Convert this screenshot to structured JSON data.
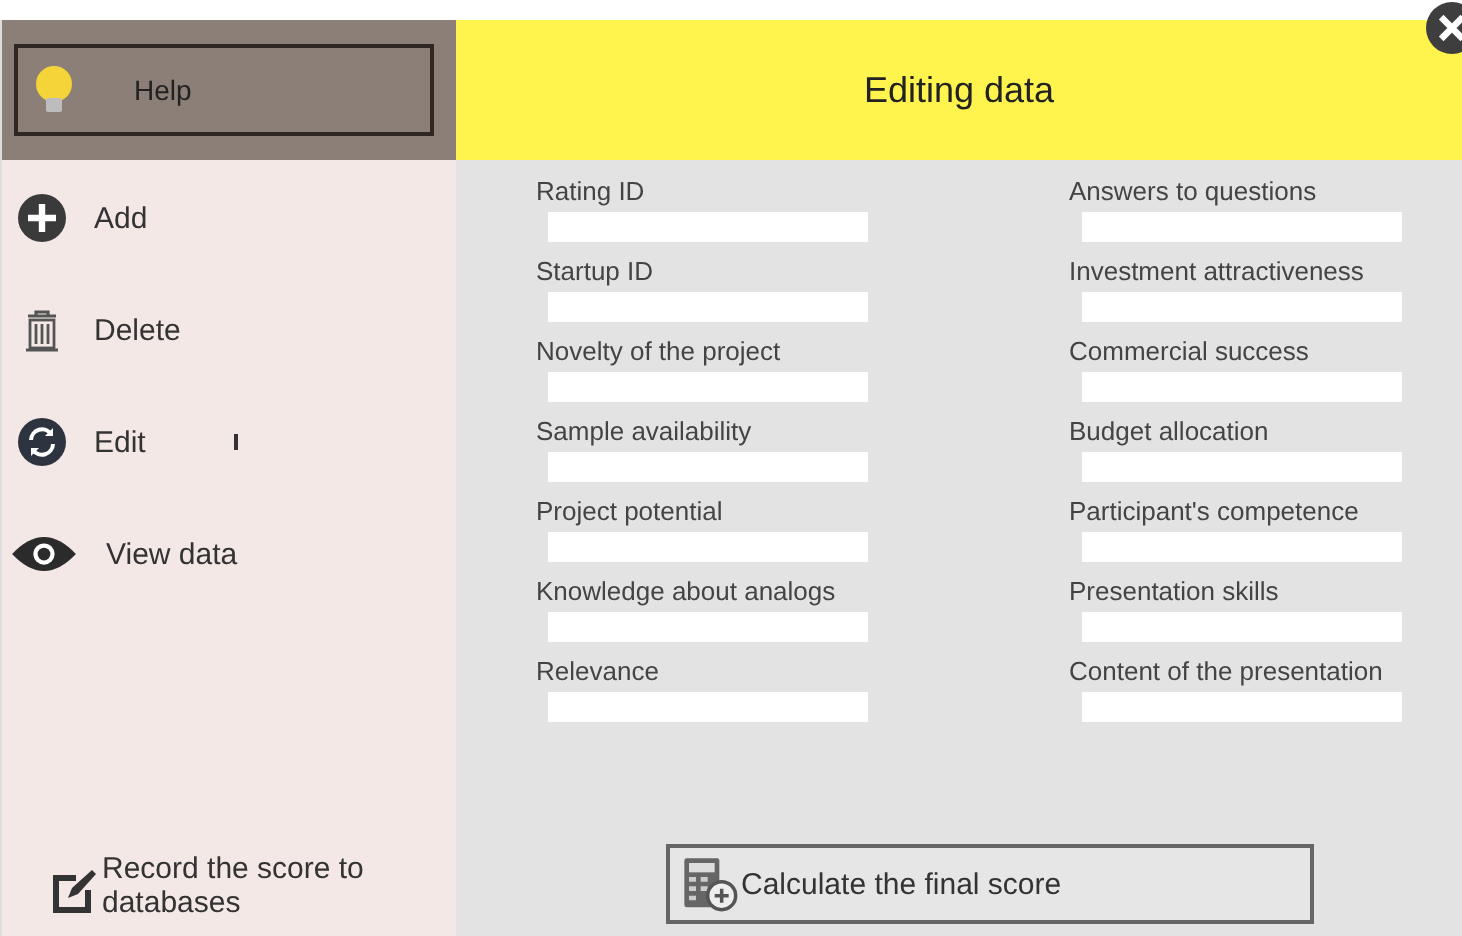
{
  "sidebar": {
    "help_button": "Help",
    "items": [
      {
        "kind": "add",
        "label": "Add"
      },
      {
        "kind": "delete",
        "label": "Delete"
      },
      {
        "kind": "edit",
        "label": "Edit"
      },
      {
        "kind": "view",
        "label": "View data"
      }
    ],
    "record_button": "Record the score to databases"
  },
  "header": {
    "title": "Editing data"
  },
  "form": {
    "left": [
      {
        "label": "Rating ID"
      },
      {
        "label": "Startup ID"
      },
      {
        "label": "Novelty of the project"
      },
      {
        "label": "Sample availability"
      },
      {
        "label": "Project potential"
      },
      {
        "label": "Knowledge about analogs"
      },
      {
        "label": "Relevance"
      }
    ],
    "right": [
      {
        "label": "Answers to questions"
      },
      {
        "label": "Investment attractiveness"
      },
      {
        "label": "Commercial success"
      },
      {
        "label": "Budget allocation"
      },
      {
        "label": "Participant's competence"
      },
      {
        "label": "Presentation skills"
      },
      {
        "label": "Content of the presentation"
      }
    ]
  },
  "calculate_button": "Calculate the final score"
}
